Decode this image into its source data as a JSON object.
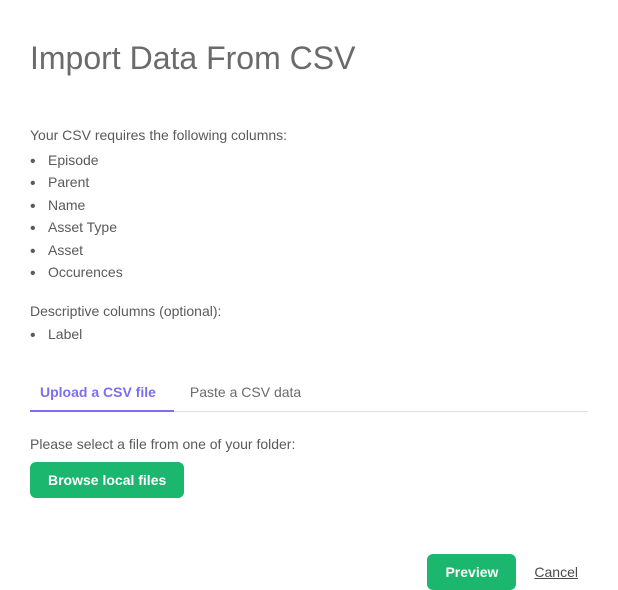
{
  "title": "Import Data From CSV",
  "requiredText": "Your CSV requires the following columns:",
  "requiredColumns": [
    "Episode",
    "Parent",
    "Name",
    "Asset Type",
    "Asset",
    "Occurences"
  ],
  "optionalText": "Descriptive columns (optional):",
  "optionalColumns": [
    "Label"
  ],
  "tabs": {
    "upload": "Upload a CSV file",
    "paste": "Paste a CSV data"
  },
  "filePrompt": "Please select a file from one of your folder:",
  "browseButton": "Browse local files",
  "footer": {
    "preview": "Preview",
    "cancel": "Cancel"
  }
}
